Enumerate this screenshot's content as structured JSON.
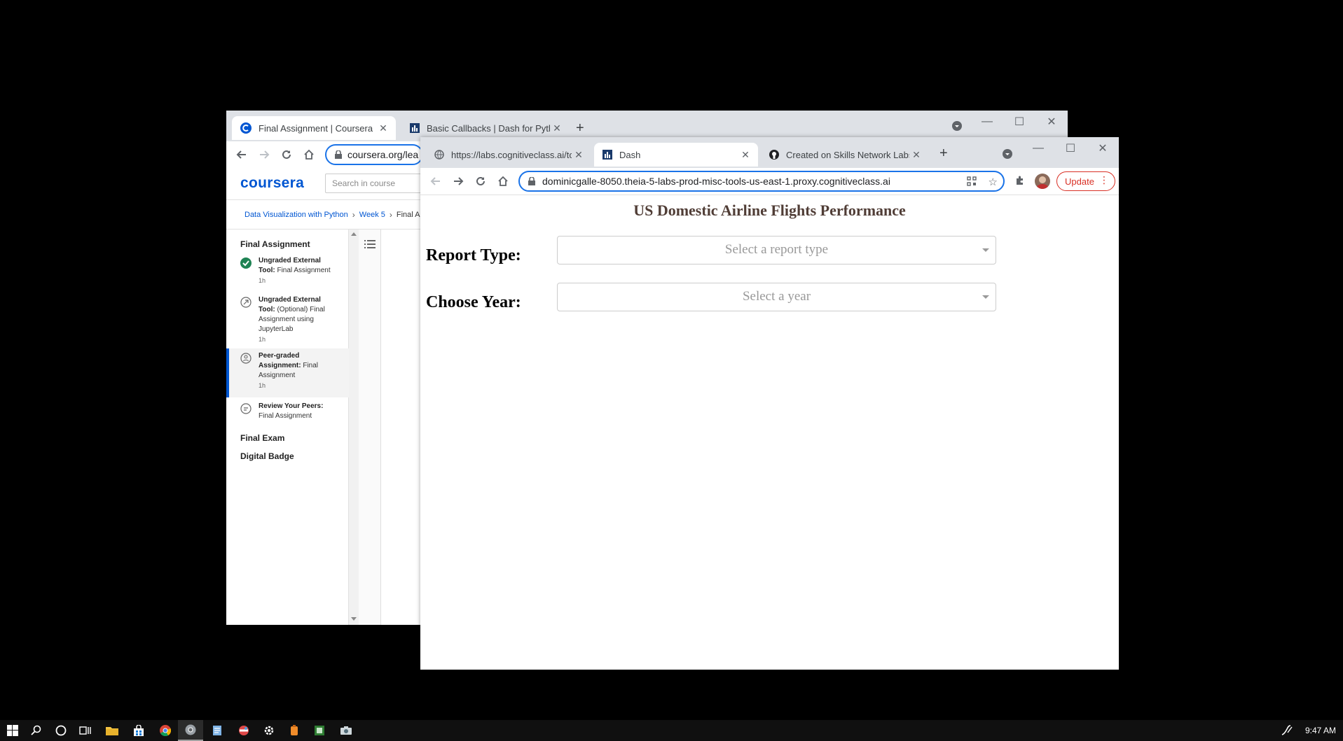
{
  "back_window": {
    "tabs": [
      {
        "title": "Final Assignment | Coursera",
        "active": true
      },
      {
        "title": "Basic Callbacks | Dash for Python",
        "active": false
      }
    ],
    "url": "coursera.org/lea",
    "coursera": {
      "logo": "coursera",
      "search_placeholder": "Search in course",
      "breadcrumb": [
        "Data Visualization with Python",
        "Week 5",
        "Final As"
      ],
      "sidebar": {
        "section_title": "Final Assignment",
        "items": [
          {
            "bold": "Ungraded External Tool:",
            "rest": " Final Assignment",
            "duration": "1h",
            "status": "completed"
          },
          {
            "bold": "Ungraded External Tool:",
            "rest": " (Optional) Final Assignment using JupyterLab",
            "duration": "1h",
            "status": "pending"
          },
          {
            "bold": "Peer-graded Assignment:",
            "rest": " Final Assignment",
            "duration": "1h",
            "status": "selected"
          },
          {
            "bold": "Review Your Peers:",
            "rest": " Final Assignment",
            "duration": "",
            "status": "pending"
          }
        ],
        "other_sections": [
          "Final Exam",
          "Digital Badge"
        ]
      }
    }
  },
  "front_window": {
    "tabs": [
      {
        "title": "https://labs.cognitiveclass.ai/tools",
        "active": false
      },
      {
        "title": "Dash",
        "active": true
      },
      {
        "title": "Created on Skills Network Labs",
        "active": false
      }
    ],
    "url": "dominicgalle-8050.theia-5-labs-prod-misc-tools-us-east-1.proxy.cognitiveclass.ai",
    "update_label": "Update",
    "dash": {
      "title": "US Domestic Airline Flights Performance",
      "report_type_label": "Report Type:",
      "report_type_placeholder": "Select a report type",
      "year_label": "Choose Year:",
      "year_placeholder": "Select a year",
      "title_color": "#503d36"
    }
  },
  "taskbar": {
    "clock": "9:47 AM"
  }
}
